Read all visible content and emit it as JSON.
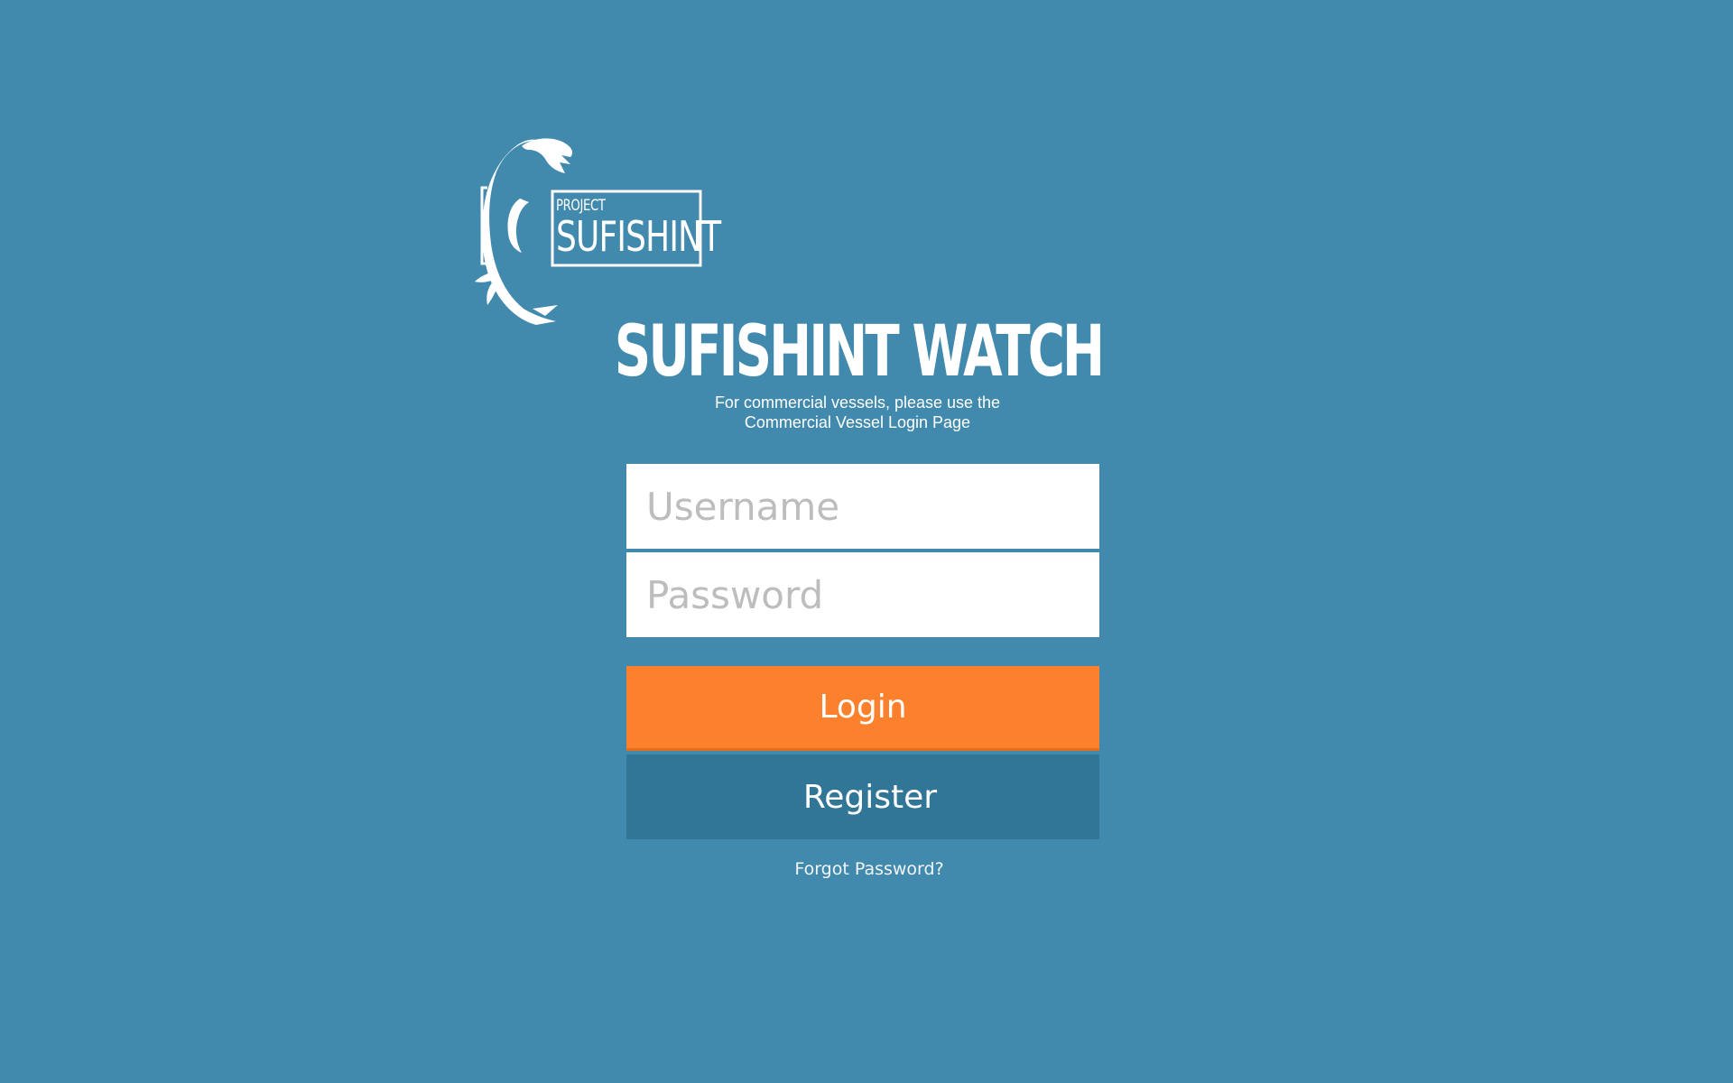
{
  "colors": {
    "background": "#418aad",
    "login_button": "#fd812d",
    "register_button": "#317597",
    "input_background": "#ffffff",
    "text": "#ffffff"
  },
  "logo": {
    "icon": "fish-icon",
    "small_text": "PROJECT",
    "big_text": "SUFISHINT"
  },
  "title": "SUFISHINT WATCH",
  "subtitle": {
    "line1": "For commercial vessels, please use the",
    "line2": "Commercial Vessel Login Page"
  },
  "form": {
    "username_placeholder": "Username",
    "username_value": "",
    "password_placeholder": "Password",
    "password_value": "",
    "login_label": "Login",
    "register_label": "Register",
    "forgot_label": "Forgot Password?"
  }
}
